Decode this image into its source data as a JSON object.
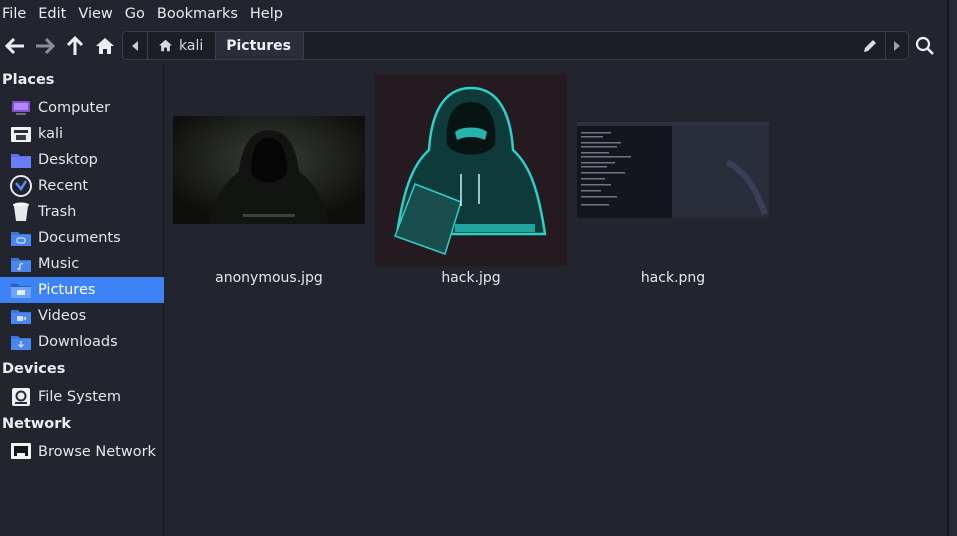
{
  "menu": [
    "File",
    "Edit",
    "View",
    "Go",
    "Bookmarks",
    "Help"
  ],
  "breadcrumb": [
    {
      "label": "kali",
      "icon": "home-icon"
    },
    {
      "label": "Pictures"
    }
  ],
  "sidebar": {
    "places_title": "Places",
    "places": [
      {
        "label": "Computer",
        "icon": "computer-icon"
      },
      {
        "label": "kali",
        "icon": "home-folder-icon"
      },
      {
        "label": "Desktop",
        "icon": "desktop-folder-icon"
      },
      {
        "label": "Recent",
        "icon": "recent-icon"
      },
      {
        "label": "Trash",
        "icon": "trash-icon"
      },
      {
        "label": "Documents",
        "icon": "documents-folder-icon"
      },
      {
        "label": "Music",
        "icon": "music-folder-icon"
      },
      {
        "label": "Pictures",
        "icon": "pictures-folder-icon",
        "selected": true
      },
      {
        "label": "Videos",
        "icon": "videos-folder-icon"
      },
      {
        "label": "Downloads",
        "icon": "downloads-folder-icon"
      }
    ],
    "devices_title": "Devices",
    "devices": [
      {
        "label": "File System",
        "icon": "drive-icon"
      }
    ],
    "network_title": "Network",
    "network": [
      {
        "label": "Browse Network",
        "icon": "network-icon"
      }
    ]
  },
  "files": [
    {
      "name": "anonymous.jpg"
    },
    {
      "name": "hack.jpg"
    },
    {
      "name": "hack.png"
    }
  ],
  "colors": {
    "accent": "#3d83f5",
    "background": "#23252e",
    "hacker_glow": "#2ad0c9"
  }
}
